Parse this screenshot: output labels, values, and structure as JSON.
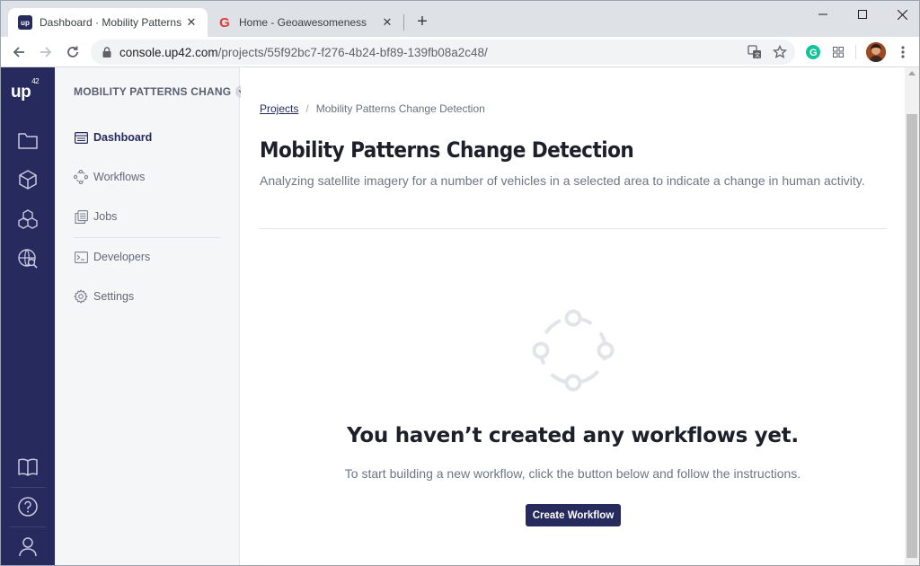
{
  "browser": {
    "tabs": [
      {
        "title": "Dashboard · Mobility Patterns Ch",
        "favicon": "up42-logo",
        "active": true
      },
      {
        "title": "Home - Geoawesomeness",
        "favicon": "geoawesomeness-g-icon",
        "active": false
      }
    ],
    "favicon_up_text": "up",
    "favicon_g_text": "G",
    "url_host": "console.up42.com",
    "url_path": "/projects/55f92bc7-f276-4b24-bf89-139fb08a2c48/"
  },
  "rail": {
    "logo": "up",
    "logo_sup": "42",
    "icons": [
      "folder-icon",
      "cube-icon",
      "blocks-icon",
      "globe-search-icon",
      "book-icon",
      "help-icon",
      "user-icon"
    ]
  },
  "sidebar": {
    "project_name": "MOBILITY PATTERNS CHANG",
    "items": [
      {
        "label": "Dashboard",
        "icon": "dashboard-icon",
        "active": true
      },
      {
        "label": "Workflows",
        "icon": "workflow-icon",
        "active": false
      },
      {
        "label": "Jobs",
        "icon": "jobs-icon",
        "active": false
      },
      {
        "label": "Developers",
        "icon": "terminal-icon",
        "active": false
      },
      {
        "label": "Settings",
        "icon": "gear-icon",
        "active": false
      }
    ]
  },
  "main": {
    "breadcrumb": {
      "root": "Projects",
      "separator": "/",
      "current": "Mobility Patterns Change Detection"
    },
    "title": "Mobility Patterns Change Detection",
    "description": "Analyzing satellite imagery for a number of vehicles in a selected area to indicate a change in human activity.",
    "empty_state": {
      "title": "You haven’t created any workflows yet.",
      "subtitle": "To start building a new workflow, click the button below and follow the instructions.",
      "button_label": "Create Workflow"
    }
  },
  "colors": {
    "brand_navy": "#262a5c",
    "sidebar_bg": "#f5f6f8",
    "text_dark": "#1d1f2b",
    "text_muted": "#6f7585"
  }
}
